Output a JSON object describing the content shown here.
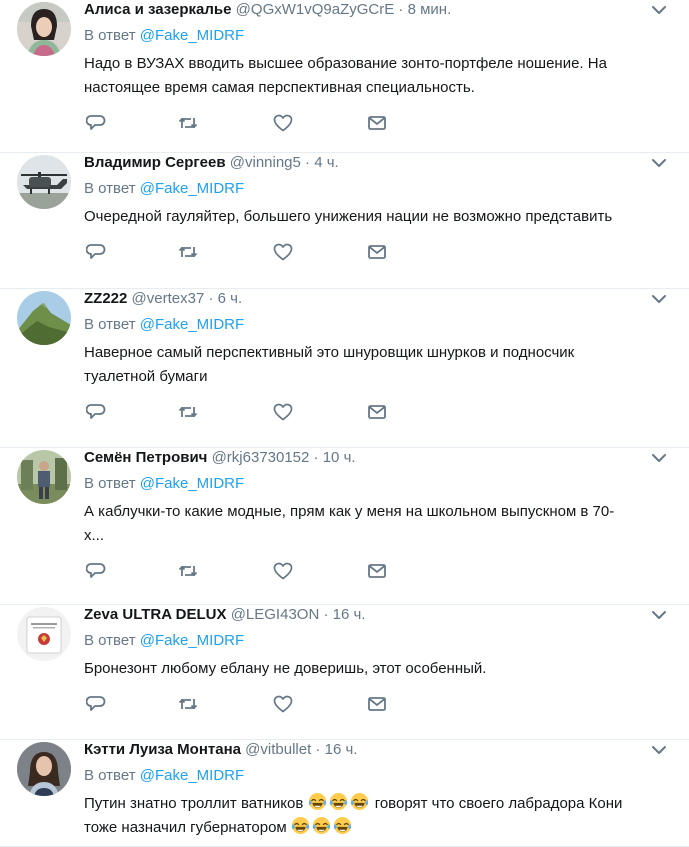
{
  "reply_prefix": "В ответ",
  "reply_to": "@Fake_MIDRF",
  "tweets": [
    {
      "name": "Алиса и зазеркалье",
      "handle": "@QGxW1vQ9aZyGCrE",
      "time": "8 мин.",
      "text_lines": [
        "Надо в ВУЗАХ вводить высшее образование зонто-портфеле ношение. На",
        "настоящее время самая перспективная специальность."
      ],
      "avatar": "woman-portrait-avatar"
    },
    {
      "name": "Владимир Сергеев",
      "handle": "@vinning5",
      "time": "4 ч.",
      "text_lines": [
        "Очередной гауляйтер, большего унижения нации не возможно представить"
      ],
      "avatar": "helicopter-avatar"
    },
    {
      "name": "ZZ222",
      "handle": "@vertex37",
      "time": "6 ч.",
      "text_lines": [
        "Наверное самый перспективный это шнуровщик шнурков и подносчик",
        "туалетной бумаги"
      ],
      "avatar": "mountain-avatar"
    },
    {
      "name": "Семён Петрович",
      "handle": "@rkj63730152",
      "time": "10 ч.",
      "text_lines": [
        "А каблучки-то какие модные, прям как у меня на школьном выпускном в 70-",
        "х..."
      ],
      "avatar": "person-outdoors-avatar"
    },
    {
      "name": "Zeva ULTRA DELUX",
      "handle": "@LEGI43ON",
      "time": "16 ч.",
      "text_lines": [
        "Бронезонт любому еблану не доверишь,  этот особенный."
      ],
      "avatar": "constitution-book-avatar"
    },
    {
      "name": "Кэтти Луиза Монтана",
      "handle": "@vitbullet",
      "time": "16 ч.",
      "text_lines": [
        "Путин знатно троллит ватников",
        "говорят что своего лабрадора Кони",
        "тоже назначил губернатором"
      ],
      "avatar": "woman-dark-hair-avatar"
    }
  ],
  "icons": {
    "caret": "chevron-down-icon",
    "reply": "reply-icon",
    "retweet": "retweet-icon",
    "like": "like-icon",
    "message": "message-icon",
    "emoji": "tears-of-joy-emoji"
  },
  "colors": {
    "link": "#1da1f2",
    "muted": "#657786",
    "text": "#14171a",
    "divider": "#e6ecf0"
  }
}
